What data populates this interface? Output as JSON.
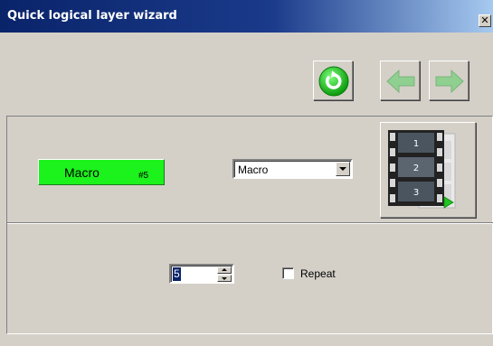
{
  "window": {
    "title": "Quick logical layer wizard",
    "close_glyph": "✕"
  },
  "toolbar": {
    "refresh_icon": "refresh-icon",
    "back_icon": "arrow-left-icon",
    "forward_icon": "arrow-right-icon",
    "back_enabled": false,
    "forward_enabled": false,
    "accent_color": "#1cc21c"
  },
  "layer": {
    "label": "Macro",
    "number": "#5",
    "label_color": "#1cf21c"
  },
  "type_select": {
    "value": "Macro"
  },
  "film_button": {
    "frames": [
      "1",
      "2",
      "3"
    ],
    "icon": "film-strip-icon"
  },
  "macro_spinner": {
    "value": "5"
  },
  "repeat": {
    "label": "Repeat",
    "checked": false
  }
}
